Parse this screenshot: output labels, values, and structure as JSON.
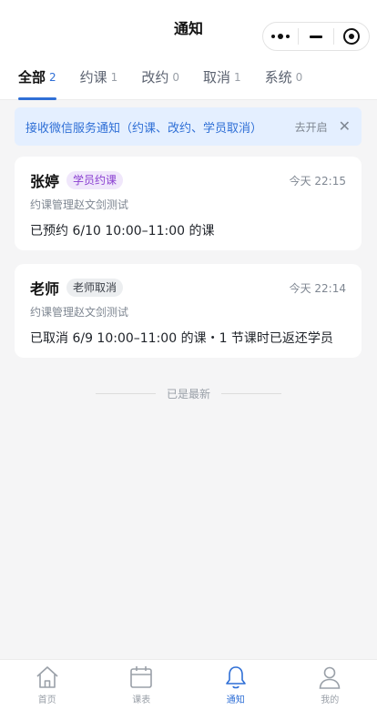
{
  "nav": {
    "title": "通知"
  },
  "tabs": [
    {
      "label": "全部",
      "count": "2",
      "active": true
    },
    {
      "label": "约课",
      "count": "1"
    },
    {
      "label": "改约",
      "count": "0"
    },
    {
      "label": "取消",
      "count": "1"
    },
    {
      "label": "系统",
      "count": "0"
    }
  ],
  "banner": {
    "text": "接收微信服务通知（约课、改约、学员取消）",
    "action": "去开启",
    "close": "✕"
  },
  "notifications": [
    {
      "name": "张婷",
      "badge": "学员约课",
      "time": "今天 22:15",
      "subtitle": "约课管理赵文剑测试",
      "body": "已预约 6/10 10:00–11:00 的课"
    },
    {
      "name": "老师",
      "badge": "老师取消",
      "time": "今天 22:14",
      "subtitle": "约课管理赵文剑测试",
      "body": "已取消 6/9 10:00–11:00 的课・1 节课时已返还学员"
    }
  ],
  "footer_note": "已是最新",
  "tabbar": [
    {
      "label": "首页",
      "icon": "home-icon"
    },
    {
      "label": "课表",
      "icon": "calendar-icon"
    },
    {
      "label": "通知",
      "icon": "bell-icon",
      "active": true
    },
    {
      "label": "我的",
      "icon": "user-icon"
    }
  ],
  "colors": {
    "accent": "#2f6fd6",
    "banner_bg": "#e4efff",
    "badge_purple": "#8a3fd1"
  }
}
